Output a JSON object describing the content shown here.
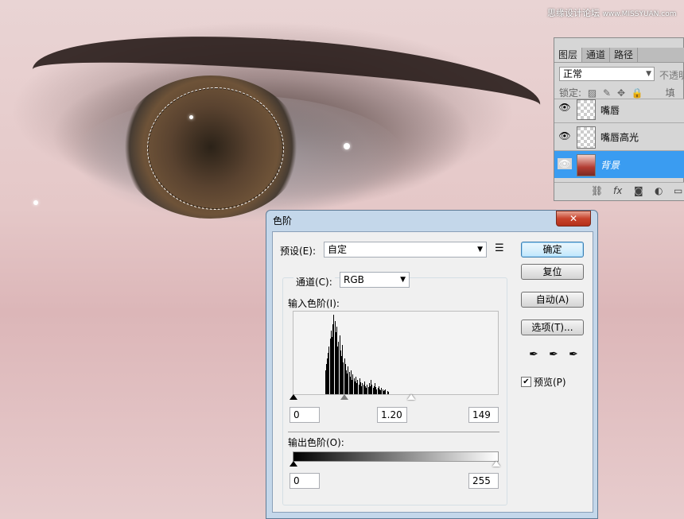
{
  "watermark": {
    "text": "思缘设计论坛",
    "site": "www.MISSYUAN.com"
  },
  "layers_panel": {
    "tabs": [
      {
        "label": "图层"
      },
      {
        "label": "通道"
      },
      {
        "label": "路径"
      }
    ],
    "blend_mode": "正常",
    "opacity_label": "不透明",
    "lock_label": "锁定:",
    "fill_label": "填",
    "layers": [
      {
        "name": "嘴唇",
        "visible": true,
        "selected": false
      },
      {
        "name": "嘴唇高光",
        "visible": true,
        "selected": false
      },
      {
        "name": "背景",
        "visible": true,
        "selected": true
      }
    ],
    "footer_icons": [
      "link-icon",
      "fx-icon",
      "mask-icon",
      "adjustment-icon",
      "group-icon"
    ]
  },
  "levels_dialog": {
    "title": "色阶",
    "close_label": "✕",
    "preset_label": "预设(E):",
    "preset_value": "自定",
    "channel_label": "通道(C):",
    "channel_value": "RGB",
    "input_levels_label": "输入色阶(I):",
    "input_black": "0",
    "input_gamma": "1.20",
    "input_white": "149",
    "output_levels_label": "输出色阶(O):",
    "output_black": "0",
    "output_white": "255",
    "buttons": {
      "ok": "确定",
      "reset": "复位",
      "auto": "自动(A)",
      "options": "选项(T)..."
    },
    "preview_label": "预览(P)",
    "preview_checked": true,
    "histogram_type": "bar",
    "histogram": {
      "type": "bar",
      "note_values_relative_height": [
        0,
        0,
        0,
        0,
        0,
        0,
        0,
        0,
        0,
        0,
        0,
        0,
        0,
        0,
        0,
        0,
        0,
        0,
        30,
        38,
        45,
        52,
        60,
        70,
        80,
        72,
        88,
        100,
        92,
        78,
        85,
        60,
        66,
        74,
        55,
        48,
        62,
        40,
        45,
        38,
        30,
        26,
        35,
        28,
        22,
        30,
        18,
        25,
        20,
        16,
        22,
        14,
        18,
        12,
        20,
        15,
        10,
        14,
        12,
        16,
        10,
        8,
        12,
        9,
        14,
        10,
        18,
        12,
        8,
        10,
        14,
        9,
        6,
        8,
        10,
        6,
        5,
        8,
        6,
        4,
        5,
        6,
        0,
        4,
        3
      ]
    }
  }
}
